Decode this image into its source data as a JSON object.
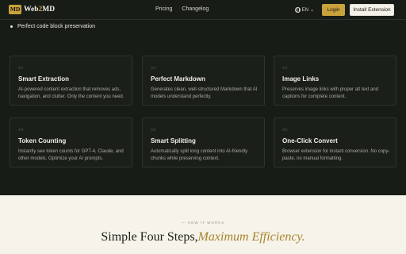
{
  "nav": {
    "logo_badge": "MD",
    "logo_part1": "Web",
    "logo_part2": "2",
    "logo_part3": "MD",
    "links": [
      "Pricing",
      "Changelog"
    ],
    "language": "EN",
    "login_label": "Login",
    "install_label": "Install Extension"
  },
  "bullet": "Perfect code block preservation",
  "features": [
    {
      "num": "01",
      "title": "Smart Extraction",
      "desc": "AI-powered content extraction that removes ads, navigation, and clutter. Only the content you need."
    },
    {
      "num": "02",
      "title": "Perfect Markdown",
      "desc": "Generates clean, well-structured Markdown that AI models understand perfectly."
    },
    {
      "num": "03",
      "title": "Image Links",
      "desc": "Preserves image links with proper alt text and captions for complete content."
    },
    {
      "num": "04",
      "title": "Token Counting",
      "desc": "Instantly see token counts for GPT-4, Claude, and other models. Optimize your AI prompts."
    },
    {
      "num": "05",
      "title": "Smart Splitting",
      "desc": "Automatically split long content into AI-friendly chunks while preserving context."
    },
    {
      "num": "06",
      "title": "One-Click Convert",
      "desc": "Browser extension for instant conversion. No copy-paste, no manual formatting."
    }
  ],
  "how": {
    "kicker": "— HOW IT WORKS",
    "title_plain": "Simple Four Steps,",
    "title_accent": "Maximum Efficiency."
  }
}
